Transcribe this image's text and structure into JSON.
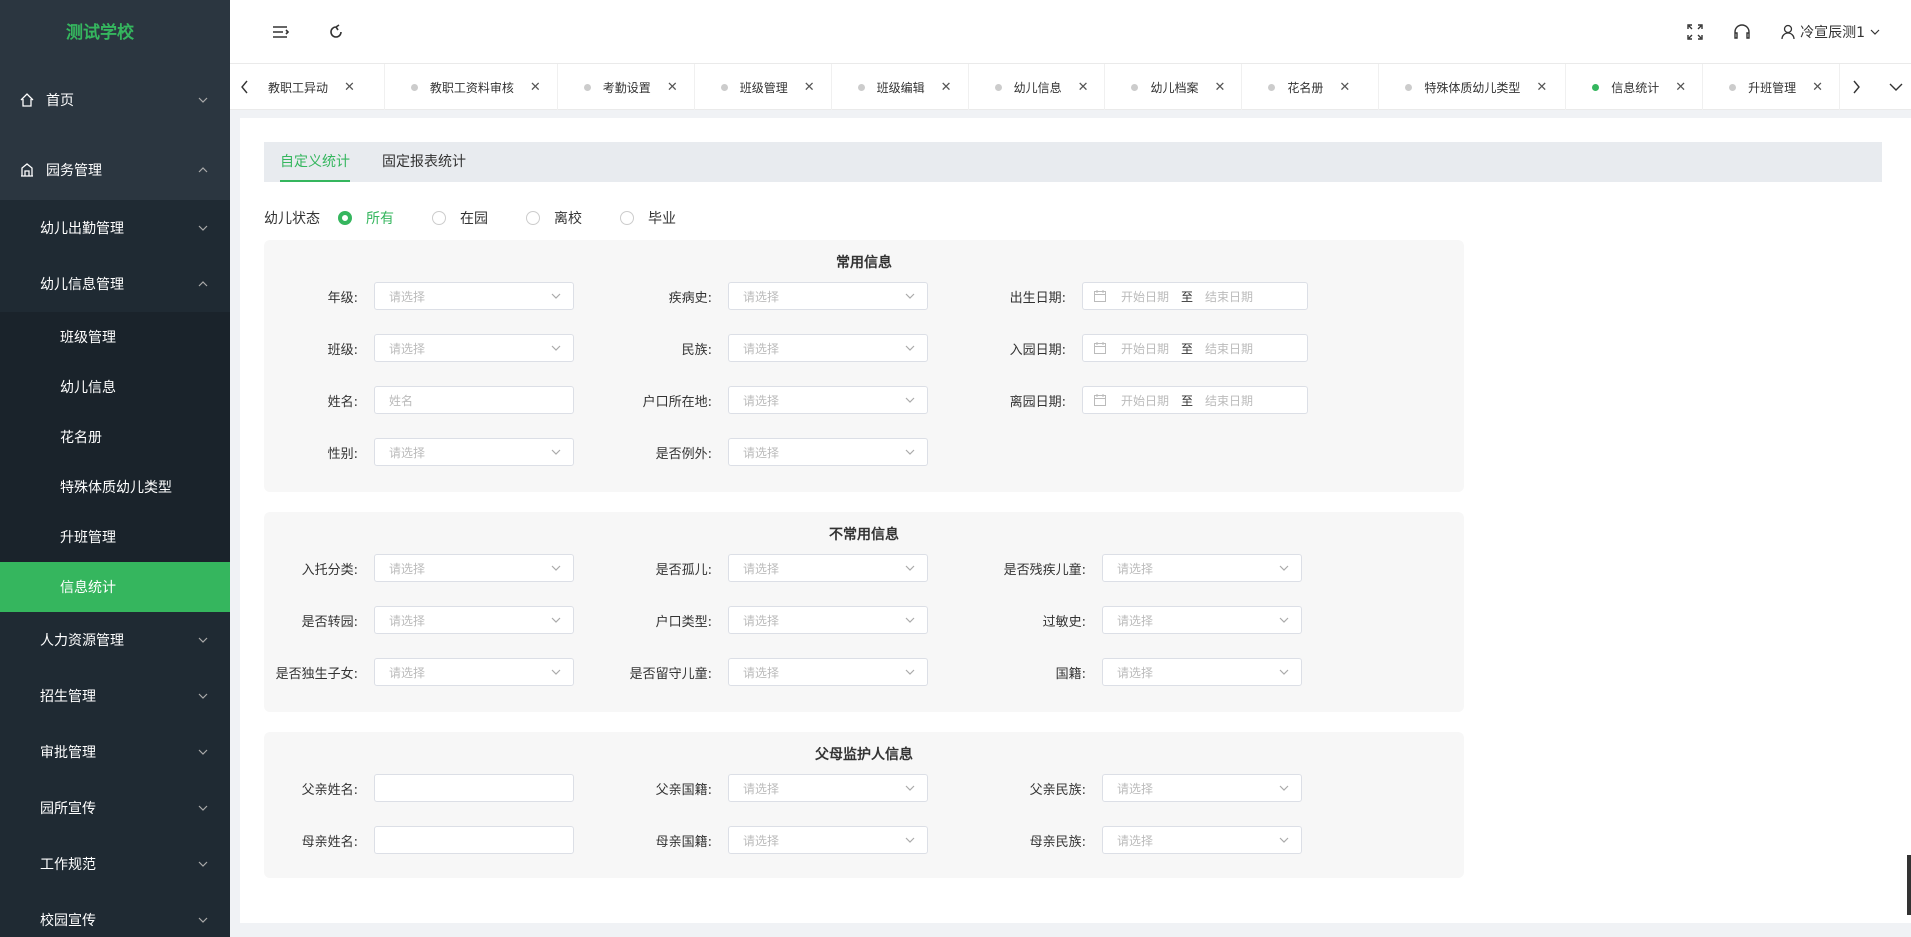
{
  "app": {
    "school_name": "测试学校"
  },
  "sidebar": {
    "items": [
      {
        "label": "首页"
      },
      {
        "label": "园务管理"
      },
      {
        "label": "幼儿出勤管理"
      },
      {
        "label": "幼儿信息管理"
      },
      {
        "label": "班级管理"
      },
      {
        "label": "幼儿信息"
      },
      {
        "label": "花名册"
      },
      {
        "label": "特殊体质幼儿类型"
      },
      {
        "label": "升班管理"
      },
      {
        "label": "信息统计"
      },
      {
        "label": "人力资源管理"
      },
      {
        "label": "招生管理"
      },
      {
        "label": "审批管理"
      },
      {
        "label": "园所宣传"
      },
      {
        "label": "工作规范"
      },
      {
        "label": "校园宣传"
      }
    ]
  },
  "header": {
    "user_name": "冷宣辰测1"
  },
  "tabs": [
    {
      "label": "教职工异动"
    },
    {
      "label": "教职工资料审核"
    },
    {
      "label": "考勤设置"
    },
    {
      "label": "班级管理"
    },
    {
      "label": "班级编辑"
    },
    {
      "label": "幼儿信息"
    },
    {
      "label": "幼儿档案"
    },
    {
      "label": "花名册"
    },
    {
      "label": "特殊体质幼儿类型"
    },
    {
      "label": "信息统计"
    },
    {
      "label": "升班管理"
    }
  ],
  "subtabs": {
    "custom": "自定义统计",
    "fixed": "固定报表统计"
  },
  "status": {
    "label": "幼儿状态",
    "options": [
      "所有",
      "在园",
      "离校",
      "毕业"
    ],
    "selected": "所有"
  },
  "placeholders": {
    "select": "请选择",
    "name": "姓名",
    "start_date": "开始日期",
    "end_date": "结束日期",
    "to": "至"
  },
  "common": {
    "title": "常用信息",
    "grade": "年级:",
    "disease": "疾病史:",
    "birth": "出生日期:",
    "class": "班级:",
    "nation": "民族:",
    "enroll": "入园日期:",
    "name": "姓名:",
    "household": "户口所在地:",
    "leave": "离园日期:",
    "gender": "性别:",
    "exception": "是否例外:"
  },
  "uncommon": {
    "title": "不常用信息",
    "care_type": "入托分类:",
    "orphan": "是否孤儿:",
    "disabled": "是否残疾儿童:",
    "transfer": "是否转园:",
    "hukou_type": "户口类型:",
    "allergy": "过敏史:",
    "only_child": "是否独生子女:",
    "left_behind": "是否留守儿童:",
    "nationality": "国籍:"
  },
  "parents": {
    "title": "父母监护人信息",
    "father_name": "父亲姓名:",
    "father_nationality": "父亲国籍:",
    "father_nation": "父亲民族:",
    "mother_name": "母亲姓名:",
    "mother_nationality": "母亲国籍:",
    "mother_nation": "母亲民族:"
  },
  "colors": {
    "accent": "#35b65e",
    "sidebar_bg": "#2b3640"
  }
}
